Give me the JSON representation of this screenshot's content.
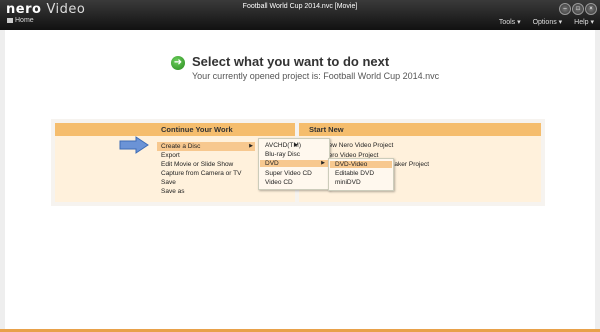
{
  "titlebar": {
    "logo_bold": "nero",
    "logo_light": "Video",
    "window_title": "Football World Cup 2014.nvc [Movie]",
    "home_label": "Home",
    "tools_label": "Tools ▾",
    "options_label": "Options ▾",
    "help_label": "Help ▾"
  },
  "header": {
    "title": "Select what you want to do next",
    "subtitle": "Your currently opened project is: Football World Cup 2014.nvc"
  },
  "continue_work": {
    "heading": "Continue Your Work",
    "items": [
      "Create a Disc",
      "Export",
      "Edit Movie or Slide Show",
      "Capture from Camera or TV",
      "Save",
      "Save as"
    ]
  },
  "start_new": {
    "heading": "Start New",
    "items": [
      "New Nero Video Project",
      "Nero Video Project",
      "Maker Project"
    ]
  },
  "disc_menu": {
    "items": [
      "AVCHD(TM)",
      "Blu-ray Disc",
      "DVD",
      "Super Video CD",
      "Video CD"
    ]
  },
  "dvd_menu": {
    "items": [
      "DVD-Video",
      "Editable DVD",
      "miniDVD"
    ]
  },
  "colors": {
    "accent": "#f5bd6d",
    "highlight": "#f7c88f",
    "panel": "#fff1dc"
  }
}
